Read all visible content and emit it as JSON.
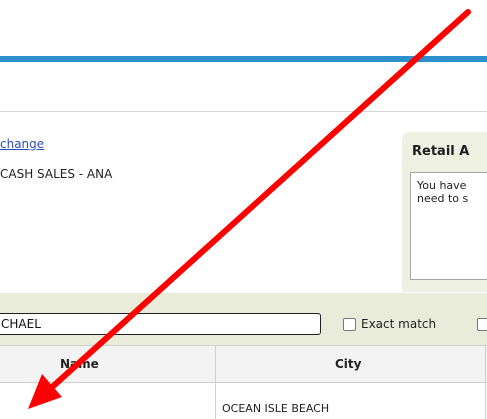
{
  "customer": {
    "change_link": "change",
    "value": "CASH SALES - ANA"
  },
  "retail_panel": {
    "title": "Retail A",
    "lines": [
      "You have",
      "need to s"
    ]
  },
  "search": {
    "value": "CHAEL",
    "exact_match_label": "Exact match"
  },
  "table": {
    "columns": [
      "Name",
      "City"
    ],
    "rows": [
      {
        "name": "",
        "city": "OCEAN ISLE BEACH"
      }
    ]
  },
  "colors": {
    "accent_stripe": "#2d8fce",
    "panel_bg": "#eef0e2",
    "search_bar_bg": "#e9ecdb",
    "annotation_arrow": "#ff0000",
    "link": "#2a4fb5"
  },
  "icons": {
    "annotation": "red-arrow-icon"
  }
}
